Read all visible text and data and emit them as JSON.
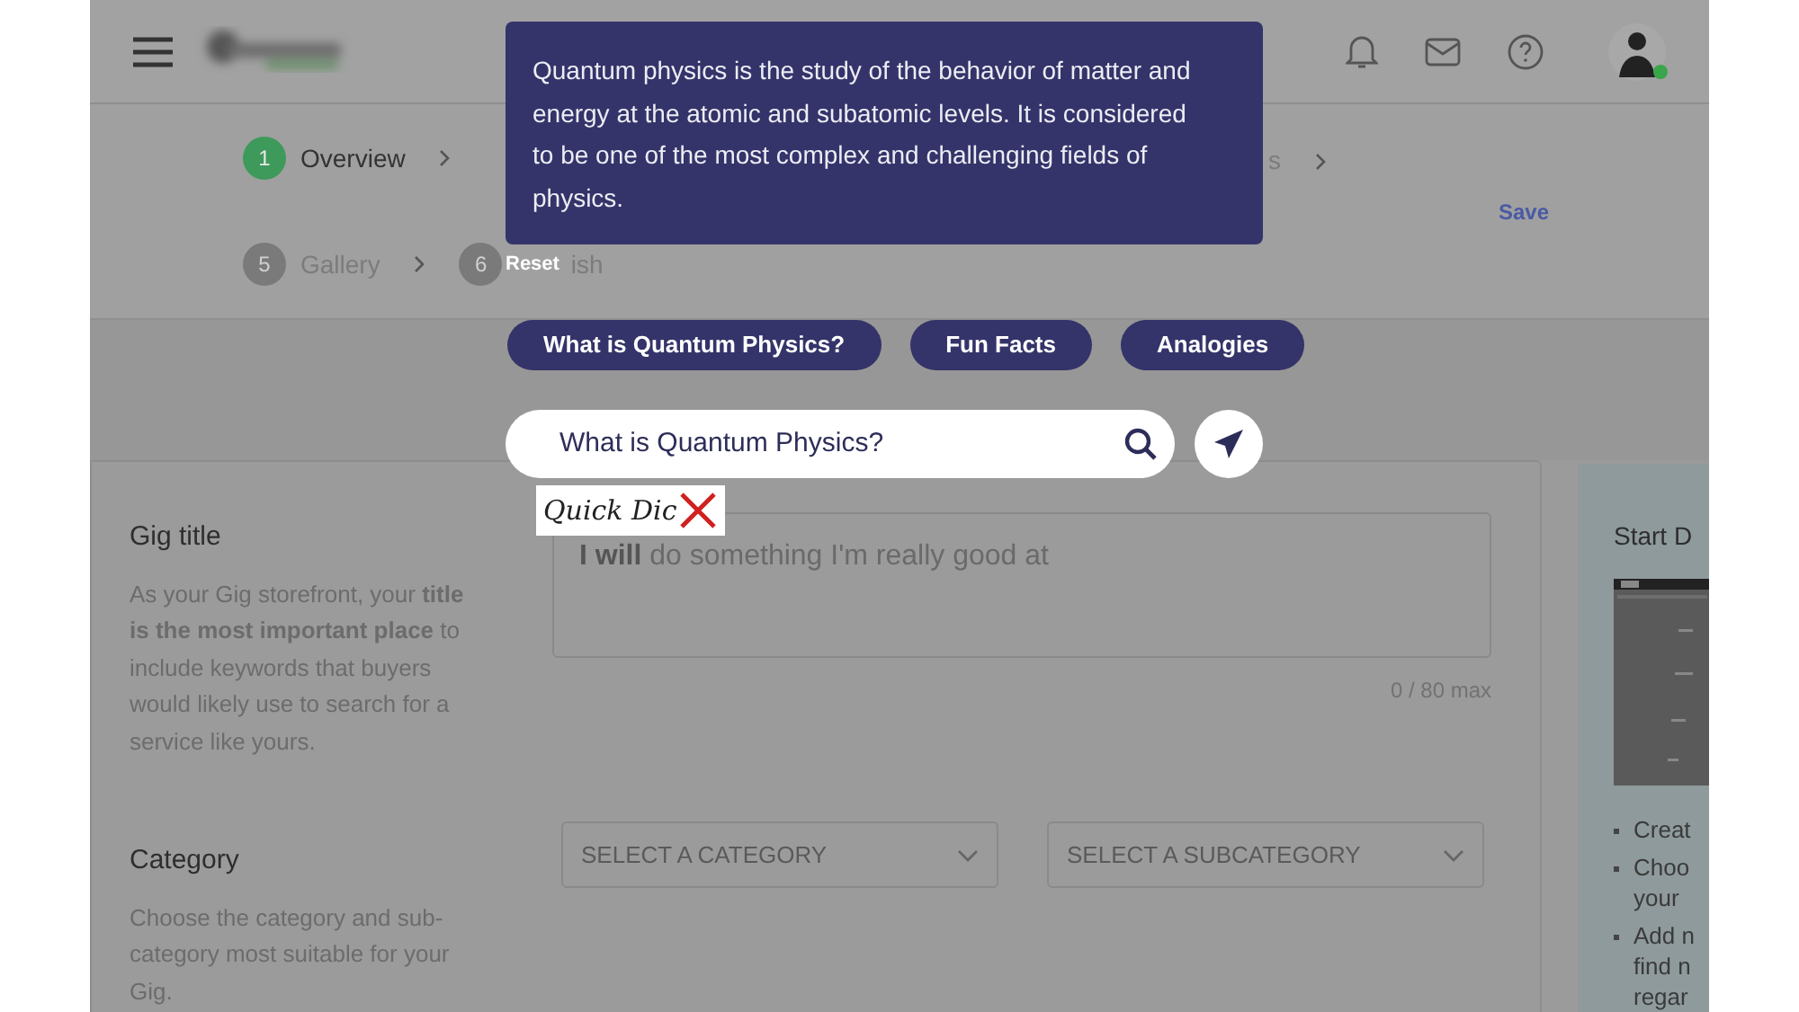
{
  "user": {
    "online": true
  },
  "steps_row1": [
    {
      "number": "1",
      "label": "Overview",
      "done": true
    }
  ],
  "steps_row1_tail": "s",
  "save": "Save",
  "steps_row2": [
    {
      "number": "5",
      "label": "Gallery",
      "done": false
    },
    {
      "number": "6",
      "label": "ish",
      "done": false
    }
  ],
  "form": {
    "sections": [
      {
        "kind": "text",
        "title": "Gig title",
        "description": "As your Gig storefront, your **title is the most important place** to include keywords that buyers would likely use to search for a service like yours.",
        "prefix": "I will",
        "placeholder": "do something I'm really good at",
        "counter": "0 / 80 max"
      },
      {
        "kind": "selects",
        "title": "Category",
        "description": "Choose the category and sub-category most suitable for your Gig.",
        "selects": [
          "SELECT A CATEGORY",
          "SELECT A SUBCATEGORY"
        ]
      }
    ]
  },
  "side_panel": {
    "title": "Start D",
    "bullets": [
      "Creat",
      "Choo\nyour",
      "Add n\nfind n\nregar"
    ]
  },
  "overlay": {
    "answer": "Quantum physics is the study of the behavior of matter and energy at the atomic and subatomic levels. It is considered to be one of the most complex and challenging fields of physics.",
    "reset": "Reset",
    "chips": [
      {
        "label": "What is Quantum Physics?"
      },
      {
        "label": "Fun Facts"
      },
      {
        "label": "Analogies"
      }
    ],
    "query": "What is Quantum Physics?",
    "logo": "Quick Dic"
  }
}
